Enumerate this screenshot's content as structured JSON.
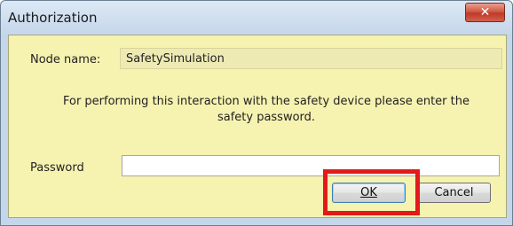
{
  "window": {
    "title": "Authorization",
    "close_symbol": "✕"
  },
  "form": {
    "node_label": "Node name:",
    "node_value": "SafetySimulation",
    "message": "For performing this interaction with the safety device please enter the safety password.",
    "password_label": "Password",
    "password_value": "",
    "password_placeholder": ""
  },
  "buttons": {
    "ok_label": "OK",
    "cancel_label": "Cancel"
  },
  "colors": {
    "panel_background": "#f6f2b0",
    "highlight_border": "#e21a1a",
    "close_button": "#c0392b"
  },
  "icons": {
    "close": "close-icon"
  }
}
